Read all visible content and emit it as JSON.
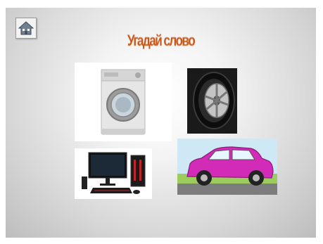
{
  "slide": {
    "title": "Угадай слово",
    "title_color": "#c8581a"
  },
  "home_button": {
    "icon": "home-icon"
  },
  "cards": [
    {
      "name": "washing-machine-card",
      "image": "washing-machine"
    },
    {
      "name": "tire-card",
      "image": "car-tire"
    },
    {
      "name": "computer-card",
      "image": "computer-setup"
    },
    {
      "name": "car-card",
      "image": "pink-car"
    }
  ]
}
